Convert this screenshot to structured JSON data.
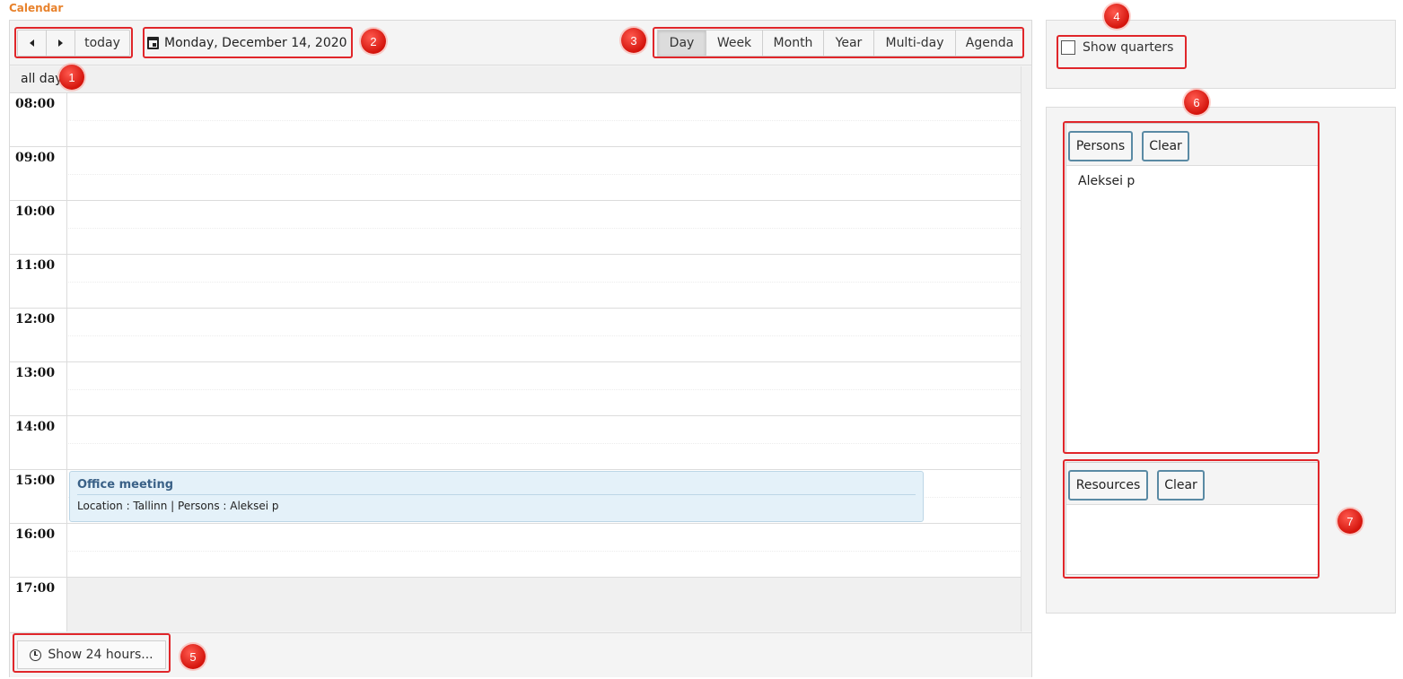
{
  "page": {
    "title": "Calendar"
  },
  "toolbar": {
    "prev_icon": "triangle-left-icon",
    "next_icon": "triangle-right-icon",
    "today_label": "today",
    "date_label": "Monday, December 14, 2020",
    "views": [
      "Day",
      "Week",
      "Month",
      "Year",
      "Multi-day",
      "Agenda"
    ],
    "active_view": "Day"
  },
  "grid": {
    "allday_label": "all day",
    "hours": [
      "08:00",
      "09:00",
      "10:00",
      "11:00",
      "12:00",
      "13:00",
      "14:00",
      "15:00",
      "16:00",
      "17:00"
    ]
  },
  "event": {
    "title": "Office meeting",
    "detail": "Location : Tallinn | Persons : Aleksei p"
  },
  "footer": {
    "show24_label": "Show 24 hours..."
  },
  "sidebar": {
    "quarters_label": "Show quarters",
    "quarters_checked": false,
    "persons": {
      "button": "Persons",
      "clear": "Clear",
      "items": [
        "Aleksei p"
      ]
    },
    "resources": {
      "button": "Resources",
      "clear": "Clear",
      "items": []
    }
  },
  "annotations": [
    "1",
    "2",
    "3",
    "4",
    "5",
    "6",
    "7"
  ],
  "colors": {
    "accent": "#e8822c",
    "highlight": "#e0262a",
    "event_bg": "#e4f1f9",
    "event_title": "#3a6187"
  }
}
